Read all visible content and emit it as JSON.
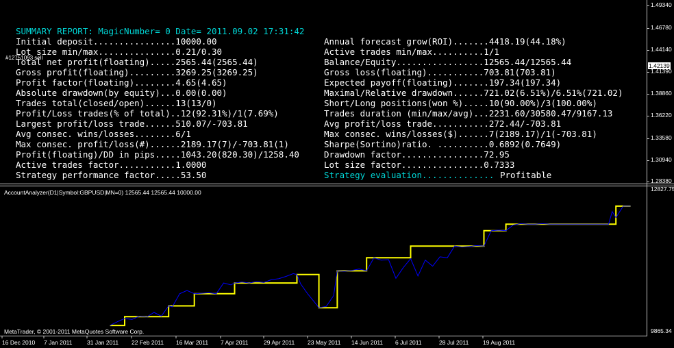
{
  "report": {
    "title": "SUMMARY REPORT: MagicNumber= 0 Date= 2011.09.02 17:31:42",
    "left": [
      "Initial deposit................10000.00",
      "Lot size min/max...............0.21/0.30",
      "Total net profit(floating).....2565.44(2565.44)",
      "Gross profit(floating).........3269.25(3269.25)",
      "Profit factor(floating)........4.65(4.65)",
      "Absolute drawdown(by equity)...0.00(0.00)",
      "Trades total(closed/open)......13(13/0)",
      "Profit/Loss trades(% of total)..12(92.31%)/1(7.69%)",
      "Largest profit/loss trade......510.07/-703.81",
      "Avg consec. wins/losses........6/1",
      "Max consec. profit/loss(#)......2189.17(7)/-703.81(1)",
      "Profit(floating)/DD in pips.....1043.20(820.30)/1258.40",
      "Active trades factor...........1.0000",
      "Strategy performance factor.....53.50"
    ],
    "right": [
      "Annual forecast grow(ROI).......4418.19(44.18%)",
      "Active trades min/max..........1/1",
      "Balance/Equity.................12565.44/12565.44",
      "Gross loss(floating)...........703.81(703.81)",
      "Expected payoff(floating).......197.34(197.34)",
      "Maximal/Relative drawdown......721.02(6.51%)/6.51%(721.02)",
      "Short/Long positions(won %).....10(90.00%)/3(100.00%)",
      "Trades duration (min/max/avg)...2231.60/30580.47/9167.13",
      "Avg profit/loss trade...........272.44/-703.81",
      "Max consec. wins/losses($)......7(2189.17)/1(-703.81)",
      "Sharpe(Sortino)ratio. ..........0.6892(0.7649)",
      "Drawdown factor................72.95",
      "Lot size factor................0.7333"
    ],
    "evaluation_label": "Strategy evaluation..............",
    "evaluation_value": "Profitable",
    "overlay_label": "#12751093 sell"
  },
  "main_axis": {
    "ticks": [
      "1.49340",
      "1.46780",
      "1.44140",
      "1.41390",
      "1.38860",
      "1.36220",
      "1.33580",
      "1.30940",
      "1.28380"
    ],
    "current_price": "1.42139"
  },
  "chart_data": {
    "type": "line",
    "title": "AccountAnalyzer(D1|Symbol:GBPUSD|MN=0) 12565.44 12565.44 10000.00",
    "copyright": "MetaTrader, © 2001-2011 MetaQuotes Software Corp.",
    "xlabels": [
      "16 Dec 2010",
      "7 Jan 2011",
      "31 Jan 2011",
      "22 Feb 2011",
      "16 Mar 2011",
      "7 Apr 2011",
      "29 Apr 2011",
      "23 May 2011",
      "14 Jun 2011",
      "6 Jul 2011",
      "28 Jul 2011",
      "19 Aug 2011"
    ],
    "ylim": [
      9865.34,
      12827.75
    ],
    "ylim_labels": [
      "12827.75",
      "9865.34"
    ],
    "x_range": [
      0,
      176
    ],
    "series": [
      {
        "color": "#ffff00",
        "x": [
          30,
          34,
          34,
          46,
          46,
          53,
          53,
          64,
          64,
          81,
          81,
          87,
          87,
          92,
          92,
          100,
          100,
          112,
          112,
          132,
          132,
          138,
          138,
          158,
          158,
          168,
          168,
          172
        ],
        "values": [
          10010,
          10010,
          10200,
          10200,
          10430,
          10430,
          10690,
          10690,
          10920,
          10920,
          11100,
          11100,
          10390,
          10390,
          11180,
          11180,
          11460,
          11460,
          11710,
          11710,
          12040,
          12040,
          12180,
          12180,
          12180,
          12180,
          12565,
          12565
        ]
      },
      {
        "color": "#0000ff",
        "x": [
          30,
          32,
          34,
          36,
          38,
          40,
          42,
          44,
          46,
          47,
          49,
          51,
          53,
          55,
          57,
          59,
          61,
          63,
          64,
          66,
          68,
          70,
          72,
          74,
          76,
          78,
          80,
          81,
          82,
          84,
          86,
          87,
          89,
          91,
          92,
          94,
          96,
          98,
          100,
          102,
          104,
          106,
          108,
          110,
          112,
          114,
          116,
          118,
          120,
          122,
          124,
          126,
          128,
          130,
          132,
          134,
          136,
          138,
          140,
          142,
          144,
          146,
          148,
          150,
          152,
          154,
          156,
          158,
          160,
          162,
          164,
          166,
          167,
          168,
          170,
          172
        ],
        "values": [
          10010,
          10090,
          10160,
          10140,
          10210,
          10190,
          10290,
          10210,
          10430,
          10410,
          10690,
          10760,
          10690,
          10700,
          10710,
          10690,
          10920,
          10880,
          10920,
          10940,
          10920,
          10950,
          10930,
          10990,
          11010,
          11060,
          11120,
          11100,
          10900,
          10680,
          10490,
          10390,
          10420,
          10650,
          11180,
          11170,
          11190,
          11220,
          11180,
          11460,
          11410,
          11420,
          11020,
          11250,
          11440,
          11070,
          11410,
          11280,
          11480,
          11460,
          11710,
          11690,
          11700,
          11720,
          11710,
          12040,
          12050,
          12040,
          12160,
          12190,
          12180,
          12180,
          12190,
          12180,
          12180,
          12180,
          12180,
          12180,
          12180,
          12180,
          12180,
          12180,
          12450,
          12320,
          12565,
          12565
        ]
      }
    ]
  }
}
